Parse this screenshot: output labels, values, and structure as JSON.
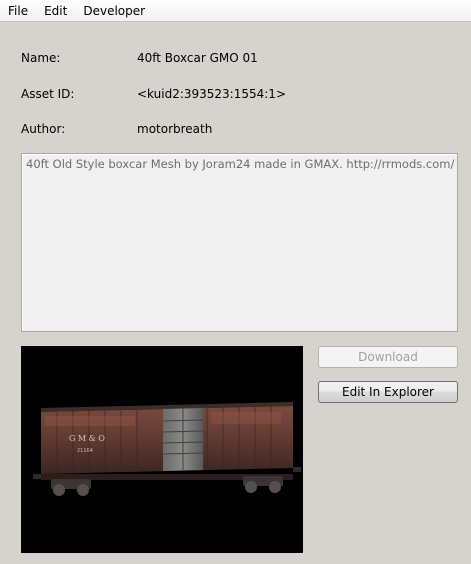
{
  "menu": {
    "file": "File",
    "edit": "Edit",
    "developer": "Developer"
  },
  "fields": {
    "name_label": "Name:",
    "name_value": "40ft Boxcar GMO 01",
    "asset_id_label": "Asset ID:",
    "asset_id_value": "<kuid2:393523:1554:1>",
    "author_label": "Author:",
    "author_value": "motorbreath"
  },
  "description": {
    "text": "40ft Old Style boxcar Mesh by Joram24 made in GMAX. http://rrmods.com/ -"
  },
  "preview": {
    "car_lettering": "G M & O",
    "car_number": "21164"
  },
  "buttons": {
    "download_label": "Download",
    "edit_in_explorer_label": "Edit In Explorer"
  }
}
